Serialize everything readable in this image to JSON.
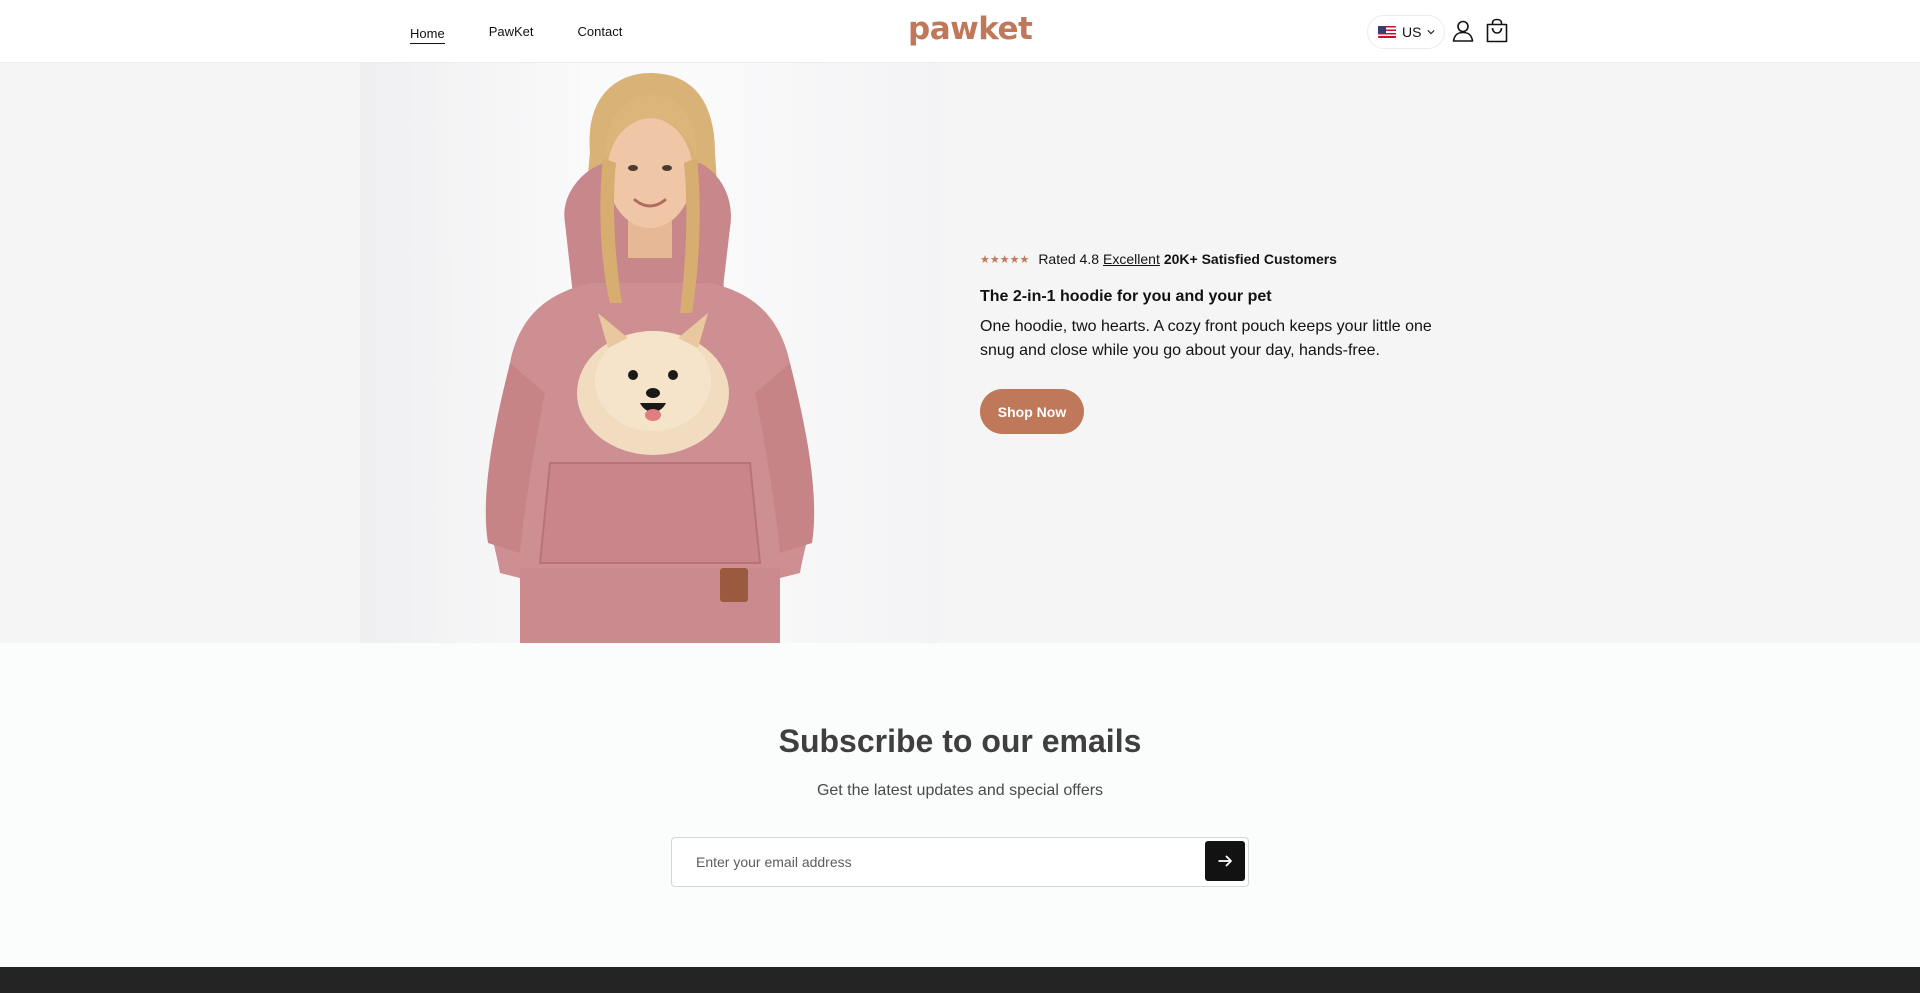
{
  "header": {
    "nav": [
      "Home",
      "PawKet",
      "Contact"
    ],
    "logo": "pawket",
    "country": {
      "code": "US",
      "flag_icon": "us-flag-icon"
    },
    "icons": [
      "account-icon",
      "cart-icon"
    ]
  },
  "hero": {
    "stars": "★★★★★",
    "rating_prefix": "Rated 4.8",
    "rating_link": "Excellent",
    "rating_customers": "20K+ Satisfied Customers",
    "heading": "The 2-in-1 hoodie for you and your pet",
    "description": "One hoodie, two hearts. A cozy front pouch keeps your little one snug and close while you go about your day, hands-free.",
    "cta": "Shop Now"
  },
  "subscribe": {
    "title": "Subscribe to our emails",
    "subtitle": "Get the latest updates and special offers",
    "placeholder": "Enter your email address",
    "submit_icon": "arrow-right-icon"
  },
  "colors": {
    "brand": "#c0785a",
    "hero_bg": "#f5f5f5",
    "footer_bg": "#242424",
    "text": "#121212"
  }
}
